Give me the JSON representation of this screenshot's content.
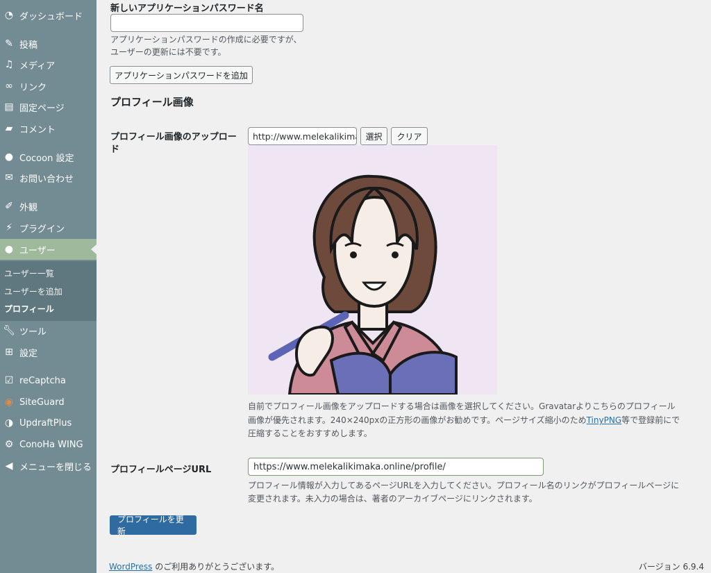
{
  "sidebar": {
    "items": [
      {
        "label": "ダッシュボード",
        "icon": "dashboard-icon"
      },
      {
        "label": "投稿",
        "icon": "pin-icon"
      },
      {
        "label": "メディア",
        "icon": "media-icon"
      },
      {
        "label": "リンク",
        "icon": "link-icon"
      },
      {
        "label": "固定ページ",
        "icon": "page-icon"
      },
      {
        "label": "コメント",
        "icon": "comment-icon"
      },
      {
        "label": "Cocoon 設定",
        "icon": "cocoon-icon"
      },
      {
        "label": "お問い合わせ",
        "icon": "mail-icon"
      },
      {
        "label": "外観",
        "icon": "brush-icon"
      },
      {
        "label": "プラグイン",
        "icon": "plugin-icon"
      },
      {
        "label": "ユーザー",
        "icon": "user-icon"
      },
      {
        "label": "ツール",
        "icon": "wrench-icon"
      },
      {
        "label": "設定",
        "icon": "settings-icon"
      },
      {
        "label": "reCaptcha",
        "icon": "check-icon"
      },
      {
        "label": "SiteGuard",
        "icon": "siteguard-icon"
      },
      {
        "label": "UpdraftPlus",
        "icon": "updraft-icon"
      },
      {
        "label": "ConoHa WING",
        "icon": "gear-icon"
      },
      {
        "label": "メニューを閉じる",
        "icon": "collapse-icon"
      }
    ],
    "submenu": [
      "ユーザー一覧",
      "ユーザーを追加",
      "プロフィール"
    ]
  },
  "app_password": {
    "label": "新しいアプリケーションパスワード名",
    "value": "",
    "desc_line1": "アプリケーションパスワードの作成に必要ですが、",
    "desc_line2": "ユーザーの更新には不要です。",
    "add_button": "アプリケーションパスワードを追加"
  },
  "profile_image": {
    "heading": "プロフィール画像",
    "upload_label_line1": "プロフィール画像のアップロー",
    "upload_label_line2": "ド",
    "url_value": "http://www.melekalikima",
    "select_button": "選択",
    "clear_button": "クリア",
    "desc_line1": "自前でプロフィール画像をアップロードする場合は画像を選択してください。Gravatarよりこちらのプロフィール",
    "desc_line2_a": "画像が優先されます。240×240pxの正方形の画像がお勧めです。ページサイズ縮小のため",
    "desc_link": "TinyPNG",
    "desc_line2_b": "等で登録前にで",
    "desc_line3": "圧縮することをおすすめします。"
  },
  "profile_url": {
    "label": "プロフィールページURL",
    "value": "https://www.melekalikimaka.online/profile/",
    "desc_line1": "プロフィール情報が入力してあるページURLを入力してください。プロフィール名のリンクがプロフィールページに",
    "desc_line2": "変更されます。未入力の場合は、著者のアーカイブページにリンクされます。"
  },
  "submit_button": "プロフィールを更新",
  "footer": {
    "link": "WordPress",
    "text": " のご利用ありがとうございます。",
    "version": "バージョン 6.9.4"
  }
}
